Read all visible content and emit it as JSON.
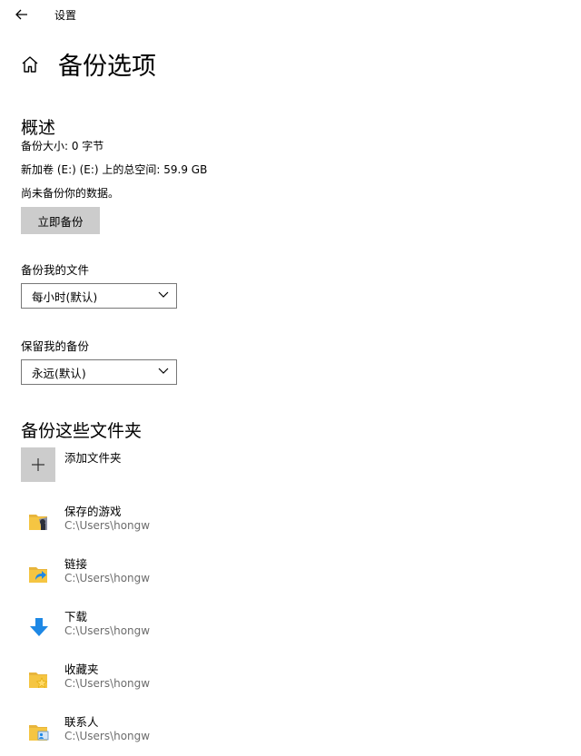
{
  "titlebar": {
    "app_title": "设置"
  },
  "header": {
    "page_title": "备份选项"
  },
  "overview": {
    "heading": "概述",
    "backup_size": "备份大小: 0 字节",
    "total_space": "新加卷 (E:) (E:) 上的总空间: 59.9 GB",
    "status": "尚未备份你的数据。",
    "backup_now_label": "立即备份"
  },
  "frequency": {
    "label": "备份我的文件",
    "selected": "每小时(默认)"
  },
  "retention": {
    "label": "保留我的备份",
    "selected": "永远(默认)"
  },
  "folders_section": {
    "heading": "备份这些文件夹",
    "add_label": "添加文件夹",
    "items": [
      {
        "name": "保存的游戏",
        "path": "C:\\Users\\hongw",
        "icon": "saved-games-folder-icon"
      },
      {
        "name": "链接",
        "path": "C:\\Users\\hongw",
        "icon": "links-folder-icon"
      },
      {
        "name": "下载",
        "path": "C:\\Users\\hongw",
        "icon": "download-arrow-icon"
      },
      {
        "name": "收藏夹",
        "path": "C:\\Users\\hongw",
        "icon": "favorites-folder-icon"
      },
      {
        "name": "联系人",
        "path": "C:\\Users\\hongw",
        "icon": "contacts-folder-icon"
      }
    ]
  },
  "colors": {
    "button_bg": "#cccccc",
    "folder_yellow": "#f5c542",
    "download_blue": "#1e88e5",
    "secondary_text": "#6d6d6d"
  }
}
